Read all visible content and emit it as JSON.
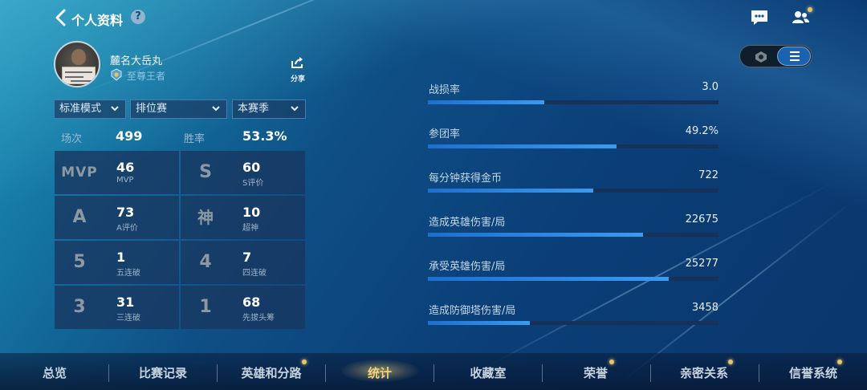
{
  "header": {
    "title": "个人资料",
    "help": "?"
  },
  "profile": {
    "name": "麓名大岳丸",
    "rank": "至尊王者",
    "share_label": "分享"
  },
  "filters": [
    {
      "label": "标准模式"
    },
    {
      "label": "排位赛"
    },
    {
      "label": "本赛季"
    }
  ],
  "summary": {
    "matches_label": "场次",
    "matches_value": "499",
    "winrate_label": "胜率",
    "winrate_value": "53.3%"
  },
  "grid": [
    {
      "badge": "MVP",
      "value": "46",
      "label": "MVP"
    },
    {
      "badge": "S",
      "value": "60",
      "label": "S评价"
    },
    {
      "badge": "A",
      "value": "73",
      "label": "A评价"
    },
    {
      "badge": "神",
      "value": "10",
      "label": "超神"
    },
    {
      "badge": "5",
      "value": "1",
      "label": "五连破"
    },
    {
      "badge": "4",
      "value": "7",
      "label": "四连破"
    },
    {
      "badge": "3",
      "value": "31",
      "label": "三连破"
    },
    {
      "badge": "1",
      "value": "68",
      "label": "先拔头筹"
    }
  ],
  "stats": [
    {
      "label": "战损率",
      "value": "3.0",
      "fill": 0.4
    },
    {
      "label": "参团率",
      "value": "49.2%",
      "fill": 0.65
    },
    {
      "label": "每分钟获得金币",
      "value": "722",
      "fill": 0.57
    },
    {
      "label": "造成英雄伤害/局",
      "value": "22675",
      "fill": 0.74
    },
    {
      "label": "承受英雄伤害/局",
      "value": "25277",
      "fill": 0.83
    },
    {
      "label": "造成防御塔伤害/局",
      "value": "3458",
      "fill": 0.35
    }
  ],
  "nav": [
    {
      "label": "总览",
      "active": false,
      "dot": false
    },
    {
      "label": "比赛记录",
      "active": false,
      "dot": false
    },
    {
      "label": "英雄和分路",
      "active": false,
      "dot": true
    },
    {
      "label": "统计",
      "active": true,
      "dot": false
    },
    {
      "label": "收藏室",
      "active": false,
      "dot": false
    },
    {
      "label": "荣誉",
      "active": false,
      "dot": true
    },
    {
      "label": "亲密关系",
      "active": false,
      "dot": true
    },
    {
      "label": "信誉系统",
      "active": false,
      "dot": true
    }
  ],
  "colors": {
    "active_tab": "#f1d27a",
    "bar_fill": "#2a86e6",
    "accent_dot": "#e9c46a"
  }
}
